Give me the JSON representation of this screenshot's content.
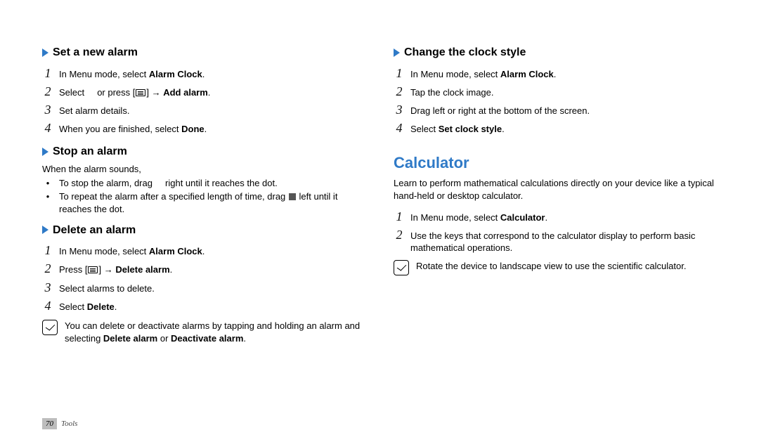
{
  "left": {
    "s1": {
      "title": "Set a new alarm",
      "items": [
        {
          "n": "1",
          "pre": "In Menu mode, select ",
          "b": "Alarm Clock",
          "post": "."
        },
        {
          "n": "2",
          "pre": "Select     or press [",
          "icon": "menu",
          "mid": "] → ",
          "b": "Add alarm",
          "post": "."
        },
        {
          "n": "3",
          "pre": "Set alarm details."
        },
        {
          "n": "4",
          "pre": "When you are finished, select ",
          "b": "Done",
          "post": "."
        }
      ]
    },
    "s2": {
      "title": "Stop an alarm",
      "lead": "When the alarm sounds,",
      "bullets": [
        {
          "pre": "To stop the alarm, drag     right until it reaches the dot."
        },
        {
          "pre": "To repeat the alarm after a specified length of time, drag ",
          "icon": "drag",
          "post": " left until it reaches the dot."
        }
      ]
    },
    "s3": {
      "title": "Delete an alarm",
      "items": [
        {
          "n": "1",
          "pre": "In Menu mode, select ",
          "b": "Alarm Clock",
          "post": "."
        },
        {
          "n": "2",
          "pre": "Press [",
          "icon": "menu",
          "mid": "] → ",
          "b": "Delete alarm",
          "post": "."
        },
        {
          "n": "3",
          "pre": "Select alarms to delete."
        },
        {
          "n": "4",
          "pre": "Select ",
          "b": "Delete",
          "post": "."
        }
      ],
      "note": {
        "pre": "You can delete or deactivate alarms by tapping and holding an alarm and selecting ",
        "b1": "Delete alarm",
        "mid": " or ",
        "b2": "Deactivate alarm",
        "post": "."
      }
    }
  },
  "right": {
    "s1": {
      "title": "Change the clock style",
      "items": [
        {
          "n": "1",
          "pre": "In Menu mode, select ",
          "b": "Alarm Clock",
          "post": "."
        },
        {
          "n": "2",
          "pre": "Tap the clock image."
        },
        {
          "n": "3",
          "pre": "Drag left or right at the bottom of the screen."
        },
        {
          "n": "4",
          "pre": "Select ",
          "b": "Set clock style",
          "post": "."
        }
      ]
    },
    "h1": "Calculator",
    "intro": "Learn to perform mathematical calculations directly on your device like a typical hand-held or desktop calculator.",
    "items": [
      {
        "n": "1",
        "pre": "In Menu mode, select ",
        "b": "Calculator",
        "post": "."
      },
      {
        "n": "2",
        "pre": "Use the keys that correspond to the calculator display to perform basic mathematical operations."
      }
    ],
    "note": "Rotate the device to landscape view to use the scientific calculator."
  },
  "footer": {
    "page": "70",
    "section": "Tools"
  }
}
